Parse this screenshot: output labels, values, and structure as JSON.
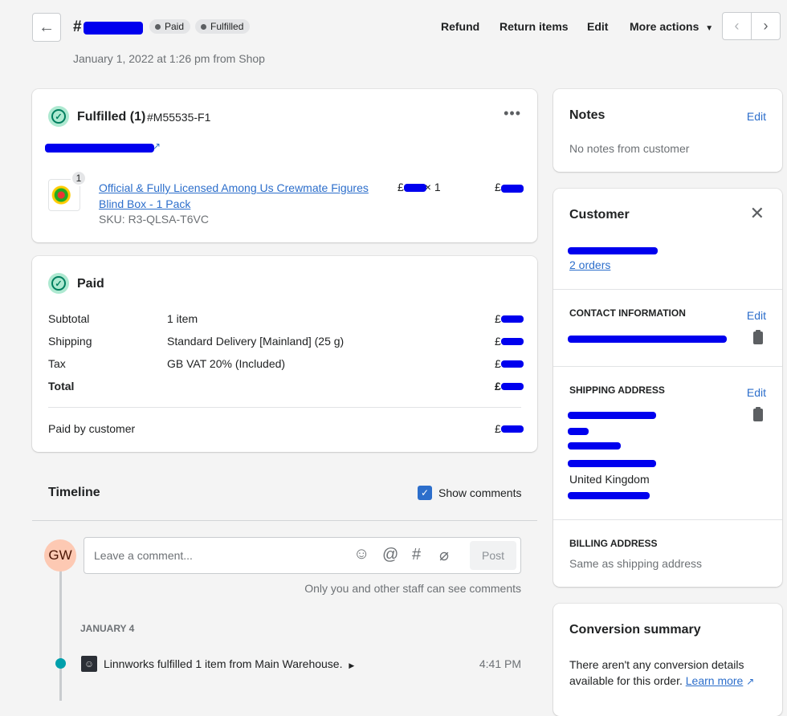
{
  "header": {
    "order_prefix": "#",
    "badges": [
      "Paid",
      "Fulfilled"
    ],
    "subtitle": "January 1, 2022 at 1:26 pm from Shop",
    "actions": {
      "refund": "Refund",
      "return_items": "Return items",
      "edit": "Edit",
      "more_actions": "More actions"
    }
  },
  "fulfilled": {
    "title": "Fulfilled (1)",
    "id": "#M55535-F1",
    "item": {
      "quantity_badge": "1",
      "name": "Official & Fully Licensed Among Us Crewmate Figures Blind Box - 1 Pack",
      "sku": "SKU: R3-QLSA-T6VC",
      "price_prefix": "£",
      "qty": "× 1",
      "total_prefix": "£"
    }
  },
  "paid": {
    "title": "Paid",
    "rows": [
      {
        "label": "Subtotal",
        "desc": "1 item",
        "amount": "£"
      },
      {
        "label": "Shipping",
        "desc": "Standard Delivery [Mainland] (25 g)",
        "amount": "£"
      },
      {
        "label": "Tax",
        "desc": "GB VAT 20% (Included)",
        "amount": "£"
      },
      {
        "label": "Total",
        "desc": "",
        "amount": "£"
      }
    ],
    "paid_by": {
      "label": "Paid by customer",
      "amount": "£"
    }
  },
  "timeline": {
    "title": "Timeline",
    "show_comments": "Show comments",
    "avatar": "GW",
    "comment_placeholder": "Leave a comment...",
    "post": "Post",
    "note": "Only you and other staff can see comments",
    "date": "JANUARY 4",
    "event": "Linnworks fulfilled 1 item from Main Warehouse.",
    "event_time": "4:41 PM"
  },
  "notes": {
    "title": "Notes",
    "edit": "Edit",
    "body": "No notes from customer"
  },
  "customer": {
    "title": "Customer",
    "orders": "2 orders",
    "contact_title": "CONTACT INFORMATION",
    "edit": "Edit",
    "shipping_title": "SHIPPING ADDRESS",
    "country": "United Kingdom",
    "billing_title": "BILLING ADDRESS",
    "billing_body": "Same as shipping address"
  },
  "conversion": {
    "title": "Conversion summary",
    "body": "There aren't any conversion details available for this order.",
    "link": "Learn more"
  },
  "colors": {
    "accent": "#2c6ecb",
    "success": "#007f5f",
    "redaction": "#0000ee"
  }
}
